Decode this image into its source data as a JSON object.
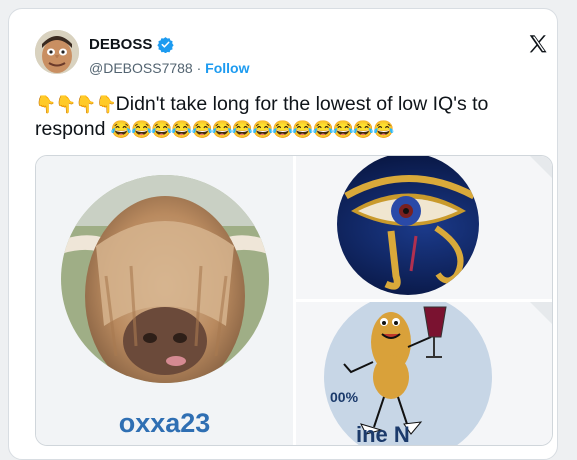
{
  "author": {
    "name": "DEBOSS",
    "handle": "@DEBOSS7788",
    "separator": "·",
    "follow_label": "Follow"
  },
  "icons": {
    "avatar": "avatar-caricature",
    "verified": "verified-badge-icon",
    "platform_logo": "x-logo-icon"
  },
  "tweet": {
    "leading_emojis": "👇👇👇👇",
    "text": "Didn't take long for the lowest of low  IQ's to",
    "text_line2": "respond",
    "trailing_emojis": "😂😂😂😂😂😂😂😂😂😂😂😂😂😂"
  },
  "media": {
    "left_caption": "oxxa23",
    "panels": [
      "highland-cow-avatar",
      "eye-of-horus-avatar",
      "peanut-mascot-avatar"
    ]
  },
  "colors": {
    "brand_blue": "#1d9bf0",
    "text": "#0f1419",
    "muted": "#536471",
    "caption_blue": "#2f6fb3"
  }
}
